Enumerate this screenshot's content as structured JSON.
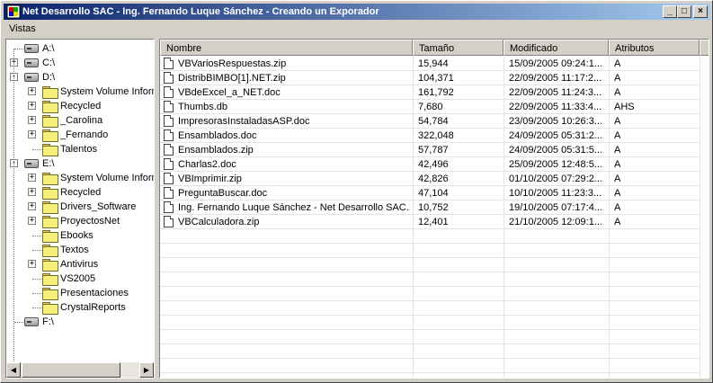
{
  "window": {
    "title": "Net Desarrollo SAC  -  Ing. Fernando Luque Sánchez  -  Creando un Exporador",
    "minimize_glyph": "_",
    "maximize_glyph": "□",
    "close_glyph": "×"
  },
  "menu": {
    "vistas": "Vistas"
  },
  "tree": {
    "a": "A:\\",
    "c": "C:\\",
    "d": "D:\\",
    "d_children": [
      "System Volume Information",
      "Recycled",
      "_Carolina",
      "_Fernando",
      "Talentos"
    ],
    "e": "E:\\",
    "e_children": [
      "System Volume Information",
      "Recycled",
      "Drivers_Software",
      "ProyectosNet",
      "Ebooks",
      "Textos",
      "Antivirus",
      "VS2005",
      "Presentaciones",
      "CrystalReports"
    ],
    "f": "F:\\"
  },
  "columns": {
    "name": "Nombre",
    "size": "Tamaño",
    "modified": "Modificado",
    "attributes": "Atributos"
  },
  "files": [
    {
      "name": "VBVariosRespuestas.zip",
      "size": "15,944",
      "modified": "15/09/2005 09:24:1...",
      "attr": "A"
    },
    {
      "name": "DistribBIMBO[1].NET.zip",
      "size": "104,371",
      "modified": "22/09/2005 11:17:2...",
      "attr": "A"
    },
    {
      "name": "VBdeExcel_a_NET.doc",
      "size": "161,792",
      "modified": "22/09/2005 11:24:3...",
      "attr": "A"
    },
    {
      "name": "Thumbs.db",
      "size": "7,680",
      "modified": "22/09/2005 11:33:4...",
      "attr": "AHS"
    },
    {
      "name": "ImpresorasInstaladasASP.doc",
      "size": "54,784",
      "modified": "23/09/2005 10:26:3...",
      "attr": "A"
    },
    {
      "name": "Ensamblados.doc",
      "size": "322,048",
      "modified": "24/09/2005 05:31:2...",
      "attr": "A"
    },
    {
      "name": "Ensamblados.zip",
      "size": "57,787",
      "modified": "24/09/2005 05:31:5...",
      "attr": "A"
    },
    {
      "name": "Charlas2.doc",
      "size": "42,496",
      "modified": "25/09/2005 12:48:5...",
      "attr": "A"
    },
    {
      "name": "VBImprimir.zip",
      "size": "42,826",
      "modified": "01/10/2005 07:29:2...",
      "attr": "A"
    },
    {
      "name": "PreguntaBuscar.doc",
      "size": "47,104",
      "modified": "10/10/2005 11:23:3...",
      "attr": "A"
    },
    {
      "name": "Ing. Fernando Luque Sánchez - Net Desarrollo SAC....",
      "size": "10,752",
      "modified": "19/10/2005 07:17:4...",
      "attr": "A"
    },
    {
      "name": "VBCalculadora.zip",
      "size": "12,401",
      "modified": "21/10/2005 12:09:1...",
      "attr": "A"
    }
  ]
}
